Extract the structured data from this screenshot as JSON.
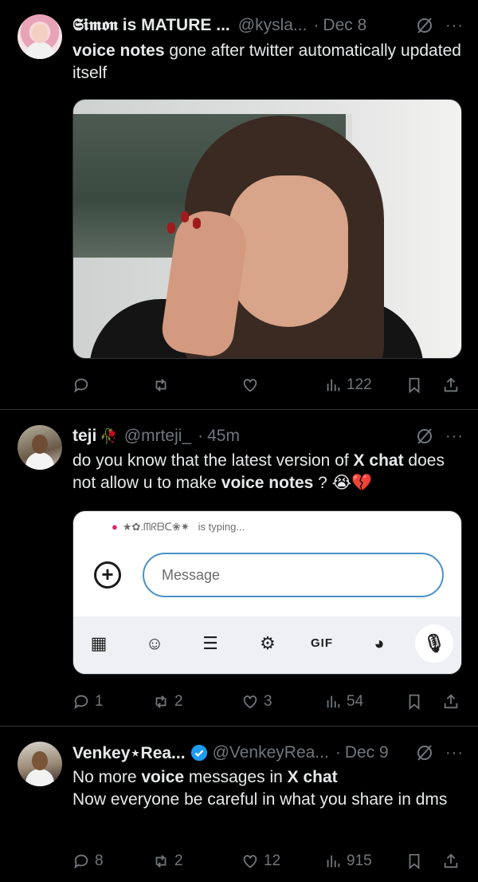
{
  "tweets": [
    {
      "display_name": "𝕾𝖎𝖒𝖔𝖓 is MATURE ...",
      "handle": "@kysla...",
      "time": "Dec 8",
      "text_pre": "",
      "text_bold1": "voice notes",
      "text_mid": " gone after twitter automatically updated itself",
      "stats": {
        "reply": "",
        "retweet": "",
        "like": "",
        "views": "122"
      }
    },
    {
      "display_name": "teji",
      "handle": "@mrteji_",
      "time": "45m",
      "text_a": "do you know that the latest version of ",
      "text_b": "X chat",
      "text_c": " does not allow u to make ",
      "text_d": "voice notes",
      "text_e": " ? 😭💔",
      "embed": {
        "typing_name": "★✿.ᗰᖇᗷᑕ❀✷",
        "typing_text": "is typing...",
        "placeholder": "Message",
        "gif_label": "GIF"
      },
      "stats": {
        "reply": "1",
        "retweet": "2",
        "like": "3",
        "views": "54"
      }
    },
    {
      "display_name": "Venkey⋆Rea...",
      "handle": "@VenkeyRea...",
      "time": "Dec 9",
      "line1_a": "No more ",
      "line1_b": "voice",
      "line1_c": " messages in ",
      "line1_d": "X chat",
      "line2": "Now everyone be careful in what you share in dms",
      "stats": {
        "reply": "8",
        "retweet": "2",
        "like": "12",
        "views": "915"
      }
    }
  ],
  "colors": {
    "background": "#000000",
    "muted": "#71767b",
    "verified": "#1d9bf0",
    "divider": "#2f3336"
  }
}
